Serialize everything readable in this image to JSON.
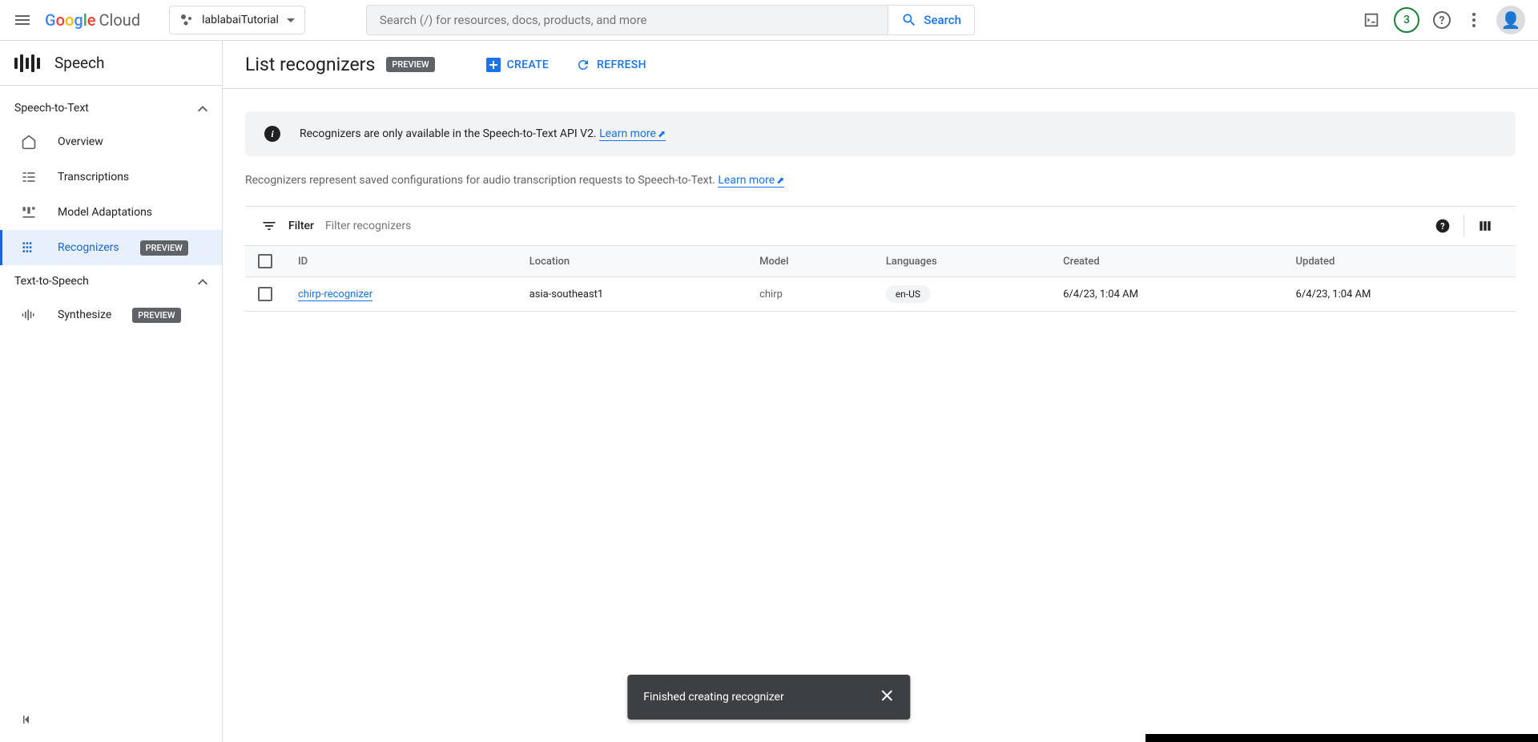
{
  "header": {
    "logo_text": "Cloud",
    "project_name": "lablabaiTutorial",
    "search_placeholder": "Search (/) for resources, docs, products, and more",
    "search_button": "Search",
    "trial_count": "3"
  },
  "sidebar": {
    "title": "Speech",
    "sections": {
      "stt": {
        "label": "Speech-to-Text",
        "items": [
          {
            "label": "Overview"
          },
          {
            "label": "Transcriptions"
          },
          {
            "label": "Model Adaptations"
          },
          {
            "label": "Recognizers",
            "preview": "PREVIEW",
            "active": true
          }
        ]
      },
      "tts": {
        "label": "Text-to-Speech",
        "items": [
          {
            "label": "Synthesize",
            "preview": "PREVIEW"
          }
        ]
      }
    }
  },
  "page": {
    "title": "List recognizers",
    "title_badge": "PREVIEW",
    "create_btn": "CREATE",
    "refresh_btn": "REFRESH",
    "banner_text": "Recognizers are only available in the Speech-to-Text API V2. ",
    "learn_more": "Learn more",
    "description": "Recognizers represent saved configurations for audio transcription requests to Speech-to-Text. ",
    "filter_label": "Filter",
    "filter_placeholder": "Filter recognizers"
  },
  "table": {
    "columns": [
      "ID",
      "Location",
      "Model",
      "Languages",
      "Created",
      "Updated"
    ],
    "rows": [
      {
        "id": "chirp-recognizer",
        "location": "asia-southeast1",
        "model": "chirp",
        "language": "en-US",
        "created": "6/4/23, 1:04 AM",
        "updated": "6/4/23, 1:04 AM"
      }
    ]
  },
  "toast": {
    "message": "Finished creating recognizer"
  }
}
